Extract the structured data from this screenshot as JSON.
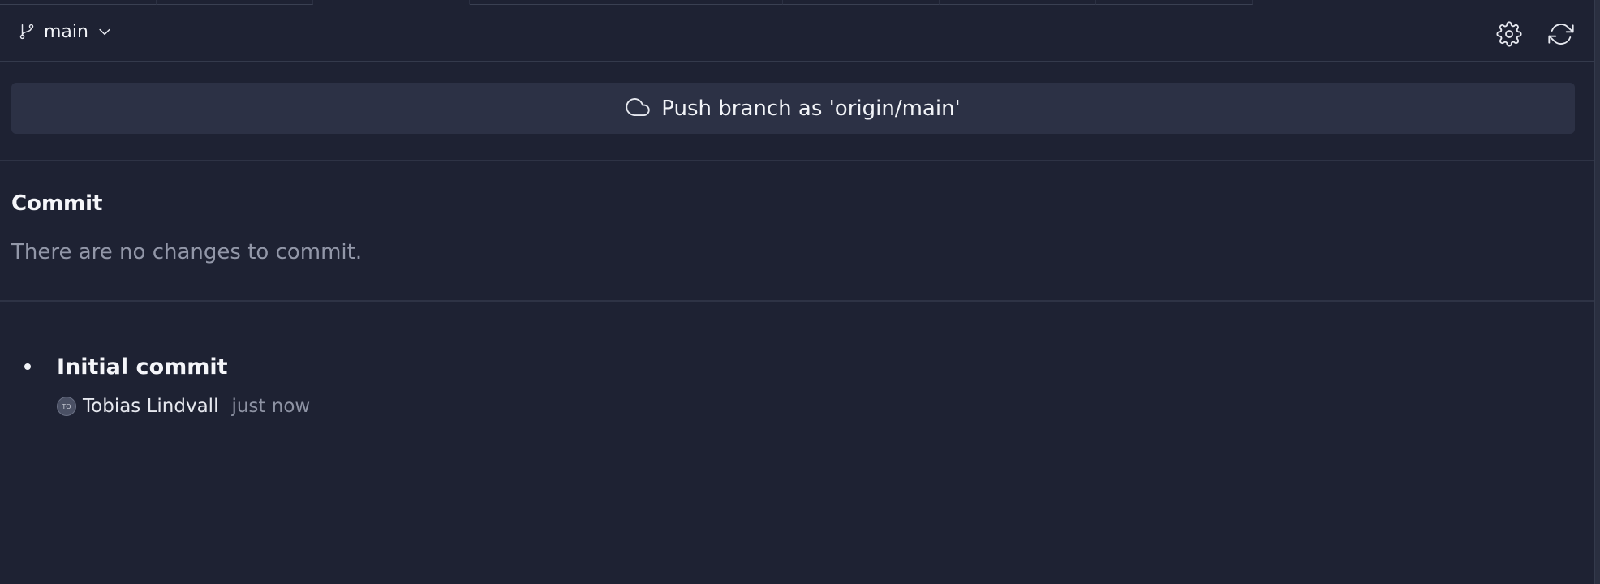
{
  "toolbar": {
    "branch_name": "main",
    "icons": {
      "branch": "git-branch-icon",
      "dropdown": "chevron-down-icon",
      "settings": "gear-icon",
      "refresh": "refresh-icon"
    }
  },
  "push": {
    "label": "Push branch as 'origin/main'",
    "icon": "cloud-icon"
  },
  "commit": {
    "heading": "Commit",
    "empty_message": "There are no changes to commit."
  },
  "history": {
    "items": [
      {
        "title": "Initial commit",
        "avatar_initials": "TO",
        "author": "Tobias Lindvall",
        "time": "just now"
      }
    ]
  },
  "colors": {
    "background": "#1e2233",
    "button": "#2c3145",
    "muted_text": "#9297a8"
  }
}
